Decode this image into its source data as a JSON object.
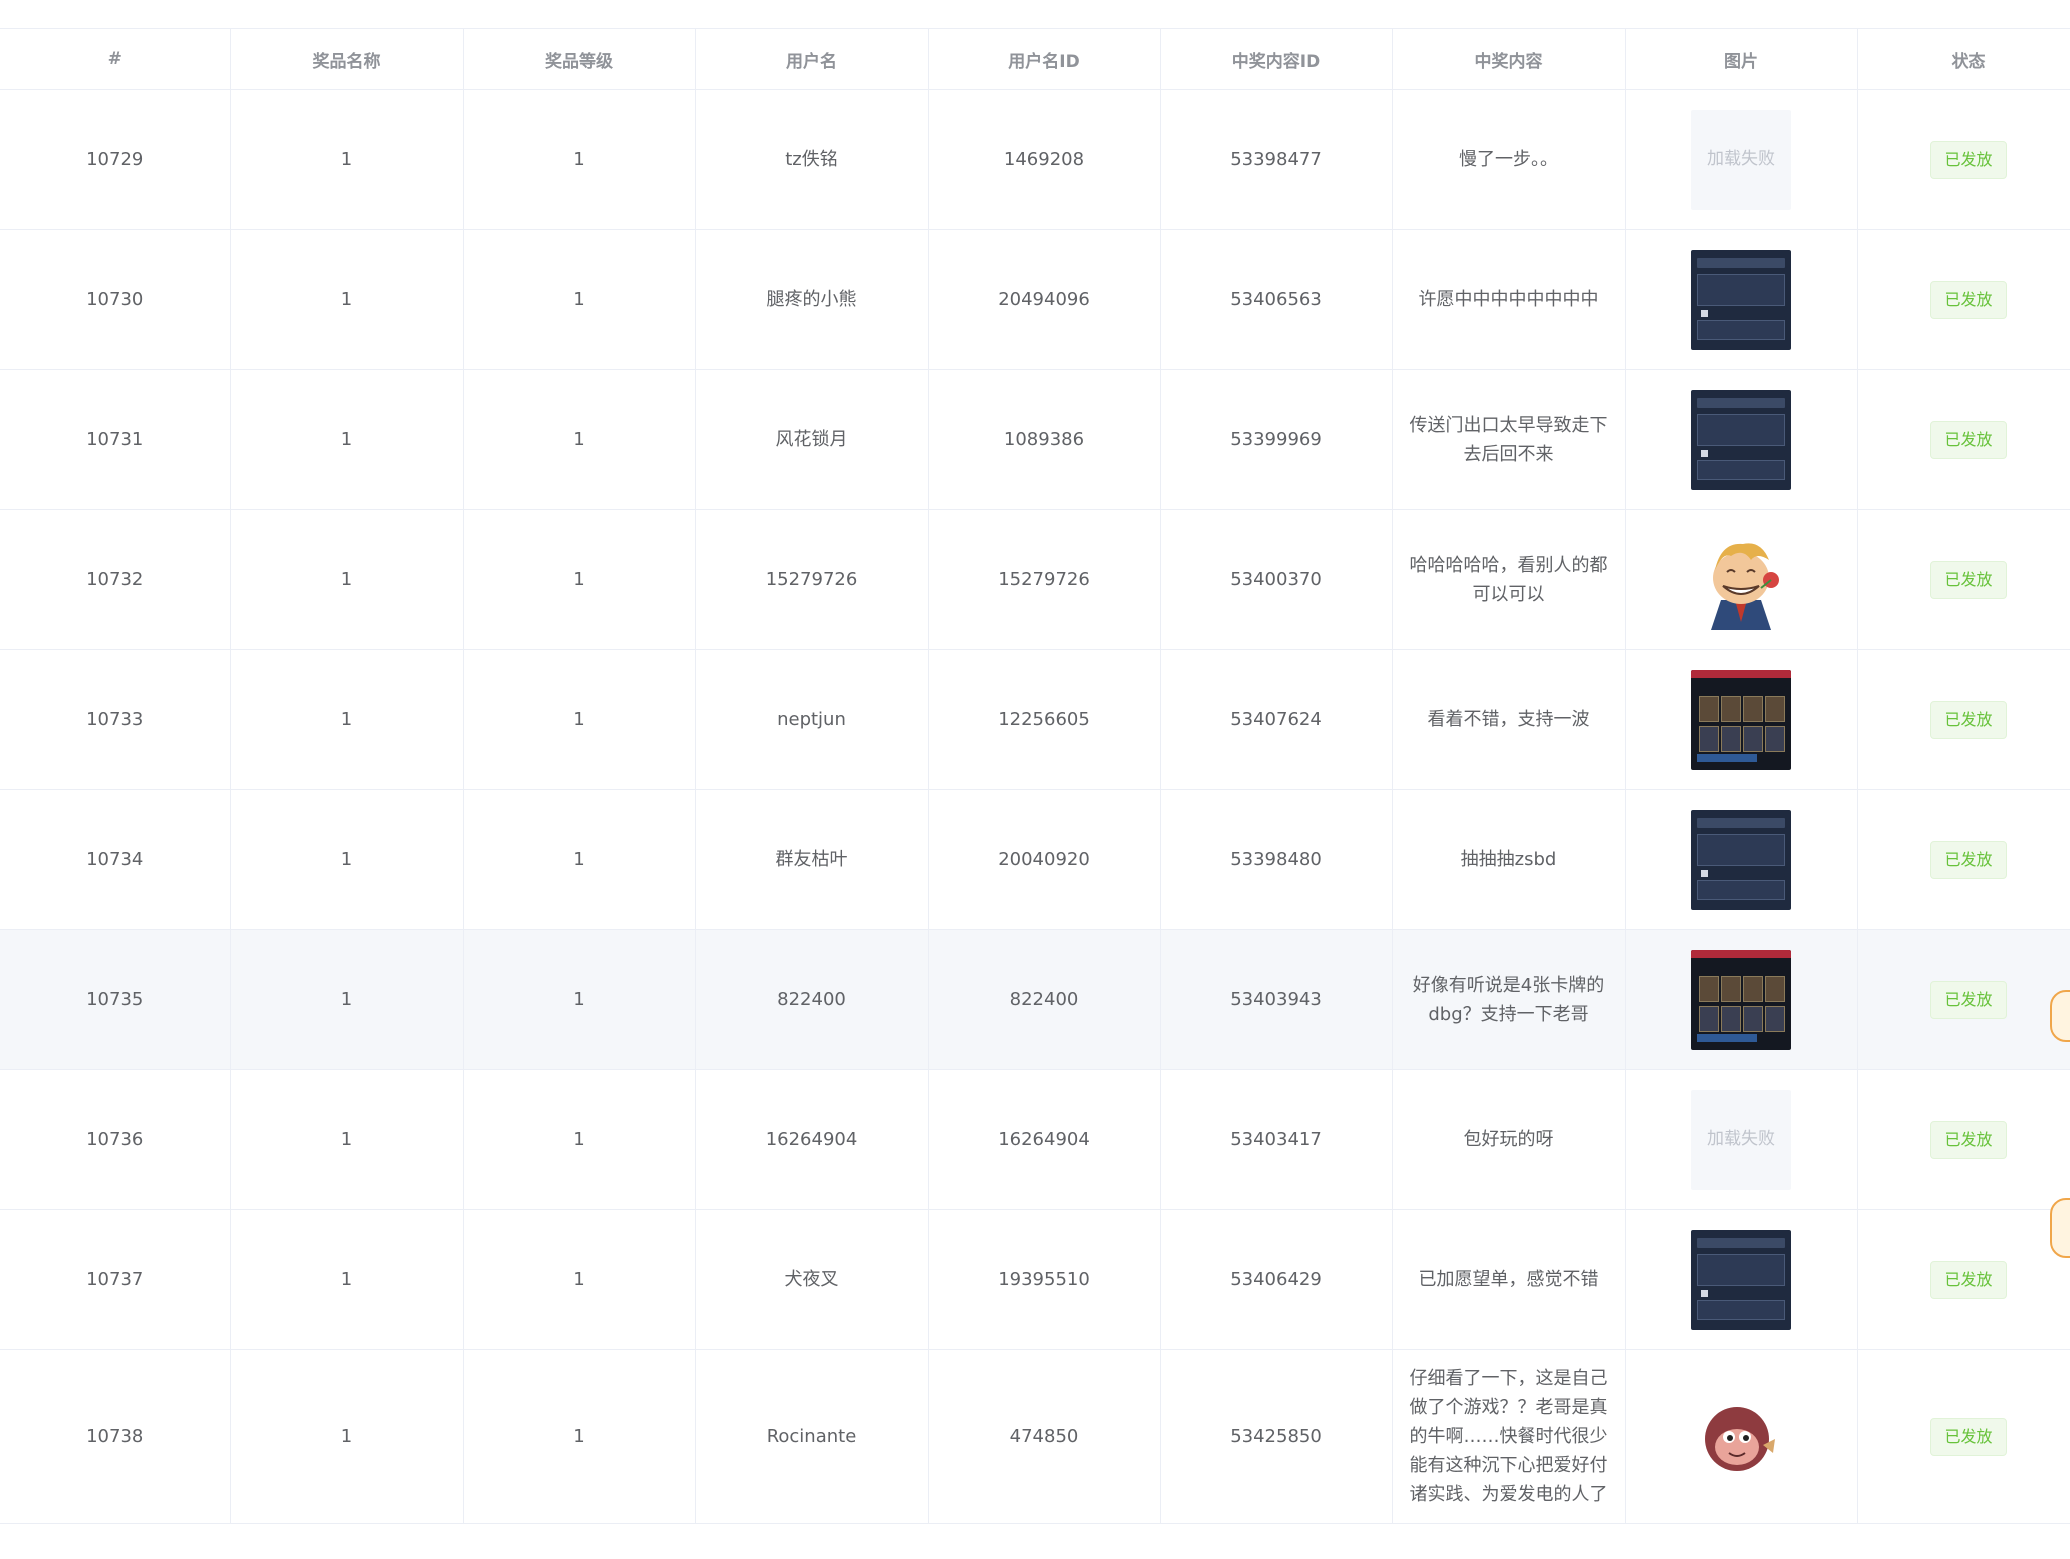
{
  "table": {
    "headers": [
      "#",
      "奖品名称",
      "奖品等级",
      "用户名",
      "用户名ID",
      "中奖内容ID",
      "中奖内容",
      "图片",
      "状态"
    ],
    "rows": [
      {
        "id": "10729",
        "prize_name": "1",
        "prize_level": "1",
        "username": "tz佚铭",
        "user_id": "1469208",
        "content_id": "53398477",
        "content": "慢了一步。。",
        "image": "加载失败",
        "status": "已发放"
      },
      {
        "id": "10730",
        "prize_name": "1",
        "prize_level": "1",
        "username": "腿疼的小熊",
        "user_id": "20494096",
        "content_id": "53406563",
        "content": "许愿中中中中中中中中",
        "image": "",
        "status": "已发放"
      },
      {
        "id": "10731",
        "prize_name": "1",
        "prize_level": "1",
        "username": "风花锁月",
        "user_id": "1089386",
        "content_id": "53399969",
        "content": "传送门出口太早导致走下去后回不来",
        "image": "",
        "status": "已发放"
      },
      {
        "id": "10732",
        "prize_name": "1",
        "prize_level": "1",
        "username": "15279726",
        "user_id": "15279726",
        "content_id": "53400370",
        "content": "哈哈哈哈哈，看别人的都可以可以",
        "image": "",
        "status": "已发放"
      },
      {
        "id": "10733",
        "prize_name": "1",
        "prize_level": "1",
        "username": "neptjun",
        "user_id": "12256605",
        "content_id": "53407624",
        "content": "看着不错，支持一波",
        "image": "",
        "status": "已发放"
      },
      {
        "id": "10734",
        "prize_name": "1",
        "prize_level": "1",
        "username": "群友枯叶",
        "user_id": "20040920",
        "content_id": "53398480",
        "content": "抽抽抽zsbd",
        "image": "",
        "status": "已发放"
      },
      {
        "id": "10735",
        "prize_name": "1",
        "prize_level": "1",
        "username": "822400",
        "user_id": "822400",
        "content_id": "53403943",
        "content": "好像有听说是4张卡牌的dbg？支持一下老哥",
        "image": "",
        "status": "已发放"
      },
      {
        "id": "10736",
        "prize_name": "1",
        "prize_level": "1",
        "username": "16264904",
        "user_id": "16264904",
        "content_id": "53403417",
        "content": "包好玩的呀",
        "image": "加载失败",
        "status": "已发放"
      },
      {
        "id": "10737",
        "prize_name": "1",
        "prize_level": "1",
        "username": "犬夜叉",
        "user_id": "19395510",
        "content_id": "53406429",
        "content": "已加愿望单，感觉不错",
        "image": "",
        "status": "已发放"
      },
      {
        "id": "10738",
        "prize_name": "1",
        "prize_level": "1",
        "username": "Rocinante",
        "user_id": "474850",
        "content_id": "53425850",
        "content": "仔细看了一下，这是自己做了个游戏？？老哥是真的牛啊……快餐时代很少能有这种沉下心把爱好付诸实践、为爱发电的人了",
        "image": "",
        "status": "已发放"
      }
    ]
  },
  "colors": {
    "header_text": "#909399",
    "cell_text": "#606266",
    "border": "#ebeef5",
    "status_green": "#67c23a",
    "status_bg": "#f0f9eb",
    "hover_row": "#f5f7fa"
  },
  "icons": {
    "image_kinds": [
      "load-failed",
      "screenshot",
      "screenshot",
      "cartoon-avatar",
      "game-screenshot",
      "screenshot",
      "game-screenshot",
      "load-failed",
      "screenshot",
      "cartoon-avatar"
    ]
  }
}
